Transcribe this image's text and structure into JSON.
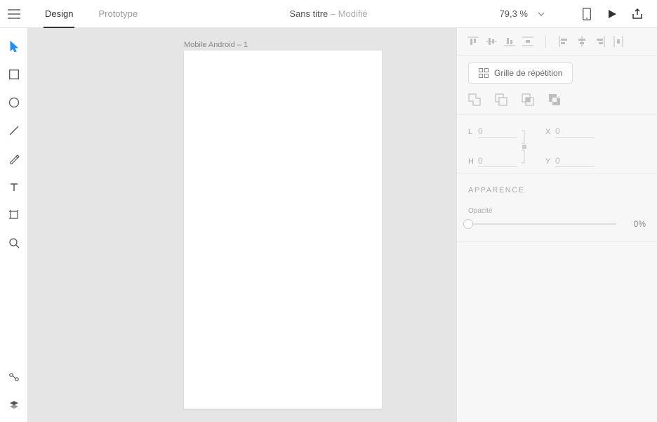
{
  "header": {
    "tabs": {
      "design": "Design",
      "prototype": "Prototype"
    },
    "title": "Sans titre",
    "title_suffix": "  –  Modifié",
    "zoom": "79,3 %"
  },
  "canvas": {
    "artboard_name": "Mobile Android – 1"
  },
  "inspector": {
    "repeat_grid": "Grille de répétition",
    "transform": {
      "l_label": "L",
      "l_val": "0",
      "h_label": "H",
      "h_val": "0",
      "x_label": "X",
      "x_val": "0",
      "y_label": "Y",
      "y_val": "0"
    },
    "appearance_title": "APPARENCE",
    "opacity_label": "Opacité",
    "opacity_value": "0%"
  }
}
